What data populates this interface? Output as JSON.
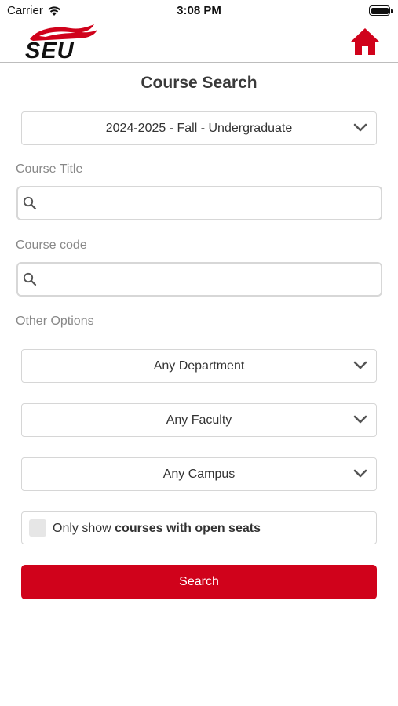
{
  "status_bar": {
    "carrier": "Carrier",
    "time": "3:08 PM",
    "battery_level": 1.0,
    "icons": [
      "wifi-icon",
      "battery-icon"
    ]
  },
  "header": {
    "logo_text": "SEU",
    "home_icon": "home-icon"
  },
  "colors": {
    "brand_red": "#d0021b",
    "label_gray": "#888888",
    "border_gray": "#d6d6d6"
  },
  "page_title": "Course Search",
  "term_select": {
    "value": "2024-2025 - Fall - Undergraduate"
  },
  "course_title": {
    "label": "Course Title",
    "value": "",
    "placeholder": "",
    "icon": "search-icon"
  },
  "course_code": {
    "label": "Course code",
    "value": "",
    "placeholder": "",
    "icon": "search-icon"
  },
  "other_options": {
    "label": "Other Options",
    "department": "Any Department",
    "faculty": "Any Faculty",
    "campus": "Any Campus"
  },
  "open_seats": {
    "prefix": "Only show ",
    "emphasis": "courses with open seats",
    "checked": false
  },
  "search_button": "Search"
}
